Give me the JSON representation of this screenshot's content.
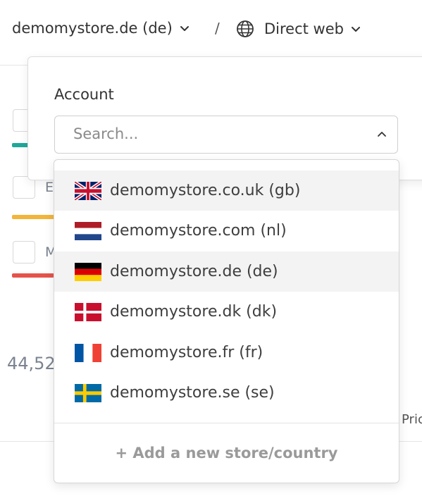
{
  "header": {
    "store_selector": "demomystore.de (de)",
    "separator": "/",
    "channel_selector": "Direct web"
  },
  "background": {
    "partial_letter_1": "E",
    "partial_letter_2": "M",
    "partial_number": "44,52",
    "partial_text": "Pric",
    "line_colors": [
      "#1fa89a",
      "#f2b53a",
      "#e5534b"
    ]
  },
  "account_popover": {
    "label": "Account",
    "search_placeholder": "Search..."
  },
  "store_options": [
    {
      "label": "demomystore.co.uk (gb)",
      "flag": "gb-flag-icon",
      "highlighted": true
    },
    {
      "label": "demomystore.com (nl)",
      "flag": "nl-flag-icon",
      "highlighted": false
    },
    {
      "label": "demomystore.de (de)",
      "flag": "de-flag-icon",
      "highlighted": true
    },
    {
      "label": "demomystore.dk (dk)",
      "flag": "dk-flag-icon",
      "highlighted": false
    },
    {
      "label": "demomystore.fr (fr)",
      "flag": "fr-flag-icon",
      "highlighted": false
    },
    {
      "label": "demomystore.se (se)",
      "flag": "se-flag-icon",
      "highlighted": false
    }
  ],
  "add_store_label": "+ Add a new store/country",
  "icons": [
    "chevron-down-icon",
    "globe-icon",
    "chevron-up-icon"
  ]
}
